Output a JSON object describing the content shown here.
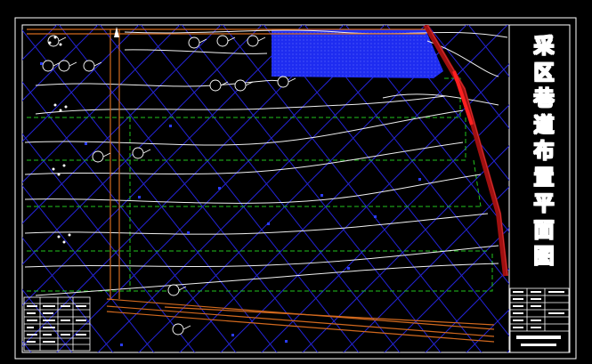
{
  "drawing": {
    "title_chars": [
      "采",
      "区",
      "巷",
      "道",
      "布",
      "置",
      "平",
      "面",
      "图"
    ],
    "colors": {
      "background": "#000000",
      "frame": "#ffffff",
      "grid": "#2424d6",
      "contour": "#f0f0f0",
      "panel_boundary": "#22c41e",
      "goaf_fill": "#1e2cf0",
      "roadway": "#d2691e",
      "fault": "#a01010",
      "fault_highlight": "#ff2020"
    },
    "icons": [
      "north-arrow-icon",
      "borehole-marker-icon",
      "legend-table-icon",
      "title-block-icon"
    ]
  }
}
